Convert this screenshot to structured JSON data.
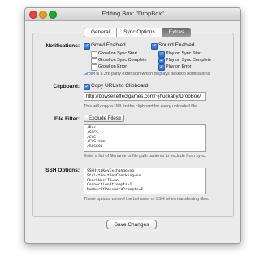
{
  "window": {
    "title": "Editing Box: \"DropBox\""
  },
  "tabs": [
    {
      "label": "General"
    },
    {
      "label": "Sync Options"
    },
    {
      "label": "Extras"
    }
  ],
  "notifications": {
    "label": "Notifications:",
    "growl": {
      "label": "Growl Enabled",
      "checked": true,
      "options": [
        {
          "label": "Growl on Sync Start",
          "checked": false
        },
        {
          "label": "Growl on Sync Complete",
          "checked": false
        },
        {
          "label": "Growl on Error",
          "checked": false
        }
      ]
    },
    "sound": {
      "label": "Sound Enabled",
      "checked": true,
      "options": [
        {
          "label": "Play on Sync Start",
          "checked": true
        },
        {
          "label": "Play on Sync Complete",
          "checked": true
        },
        {
          "label": "Play on Error",
          "checked": true
        }
      ]
    },
    "note_link": "Growl",
    "note_text": " is a 3rd party extension which displays desktop notifications."
  },
  "clipboard": {
    "label": "Clipboard:",
    "checkbox_label": "Copy URLs to Clipboard",
    "checked": true,
    "url": "http://bowser.effectgames.com/~jhuckaby/DropBox/",
    "note": "This will copy a URL to the clipboard for every uploaded file."
  },
  "file_filter": {
    "label": "File Filter:",
    "mode": "Exclude Files",
    "lines": [
      "/Rcs",
      "/SCCS",
      "/CVS",
      "/CVS.adm",
      "/RCSLOG"
    ],
    "note": "Enter a list of filename or file path patterns to exclude from sync."
  },
  "ssh": {
    "label": "SSH Options:",
    "lines": [
      "SSHHttpKeyExchange=no",
      "StrictHostKeyChecking=no",
      "CheckHostIP=no",
      "ConnectionAttempts=1",
      "NumberOfPasswordPrompts=1"
    ],
    "note": "These options control the behavior of SSH when transferring files."
  },
  "save_button": {
    "label": "Save Changes"
  }
}
